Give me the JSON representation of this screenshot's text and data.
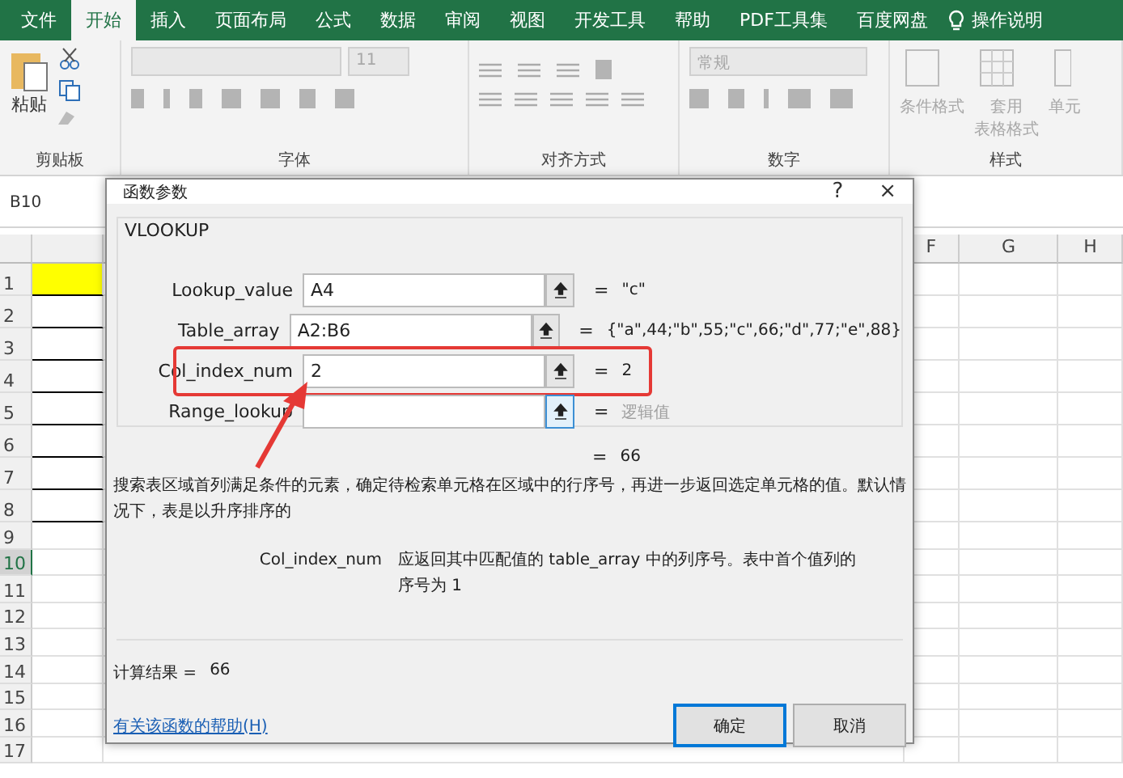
{
  "ribbon_tabs": [
    {
      "label": "文件",
      "selected": false
    },
    {
      "label": "开始",
      "selected": true
    },
    {
      "label": "插入",
      "selected": false
    },
    {
      "label": "页面布局",
      "selected": false
    },
    {
      "label": "公式",
      "selected": false
    },
    {
      "label": "数据",
      "selected": false
    },
    {
      "label": "审阅",
      "selected": false
    },
    {
      "label": "视图",
      "selected": false
    },
    {
      "label": "开发工具",
      "selected": false
    },
    {
      "label": "帮助",
      "selected": false
    },
    {
      "label": "PDF工具集",
      "selected": false
    },
    {
      "label": "百度网盘",
      "selected": false
    }
  ],
  "tell_me": "操作说明",
  "ribbon": {
    "paste": "粘贴",
    "font_size": "11",
    "number_format": "常规",
    "conditional_format": "条件格式",
    "table_format_1": "套用",
    "table_format_2": "表格格式",
    "cell_styles": "单元",
    "groups": [
      "剪贴板",
      "字体",
      "对齐方式",
      "数字",
      "样式"
    ]
  },
  "name_box": "B10",
  "sheet": {
    "columns": [
      "F",
      "G",
      "H"
    ],
    "rows": [
      {
        "label": "1",
        "selected": false
      },
      {
        "label": "2",
        "selected": false
      },
      {
        "label": "3",
        "selected": false
      },
      {
        "label": "4",
        "selected": false
      },
      {
        "label": "5",
        "selected": false
      },
      {
        "label": "6",
        "selected": false
      },
      {
        "label": "7",
        "selected": false
      },
      {
        "label": "8",
        "selected": false
      },
      {
        "label": "9",
        "selected": false
      },
      {
        "label": "10",
        "selected": true
      },
      {
        "label": "11",
        "selected": false
      },
      {
        "label": "12",
        "selected": false
      },
      {
        "label": "13",
        "selected": false
      },
      {
        "label": "14",
        "selected": false
      },
      {
        "label": "15",
        "selected": false
      },
      {
        "label": "16",
        "selected": false
      },
      {
        "label": "17",
        "selected": false
      }
    ]
  },
  "dialog": {
    "title": "函数参数",
    "help": "?",
    "close": "×",
    "function": "VLOOKUP",
    "args": [
      {
        "name": "Lookup_value",
        "value": "A4",
        "result": "\"c\"",
        "hint": false,
        "highlighted": false,
        "focused": false
      },
      {
        "name": "Table_array",
        "value": "A2:B6",
        "result": "{\"a\",44;\"b\",55;\"c\",66;\"d\",77;\"e\",88}",
        "hint": false,
        "highlighted": false,
        "focused": false
      },
      {
        "name": "Col_index_num",
        "value": "2",
        "result": "2",
        "hint": false,
        "highlighted": true,
        "focused": false
      },
      {
        "name": "Range_lookup",
        "result": "逻辑值",
        "hint": true,
        "highlighted": false,
        "focused": true
      }
    ],
    "eq": "=",
    "total": "66",
    "description": "搜索表区域首列满足条件的元素，确定待检索单元格在区域中的行序号，再进一步返回选定单元格的值。默认情况下，表是以升序排序的",
    "param_name": "Col_index_num",
    "param_description": "应返回其中匹配值的 table_array 中的列序号。表中首个值列的序号为 1",
    "calc_label": "计算结果 =",
    "calc_value": "66",
    "help_link": "有关该函数的帮助(H)",
    "ok": "确定",
    "cancel": "取消"
  }
}
